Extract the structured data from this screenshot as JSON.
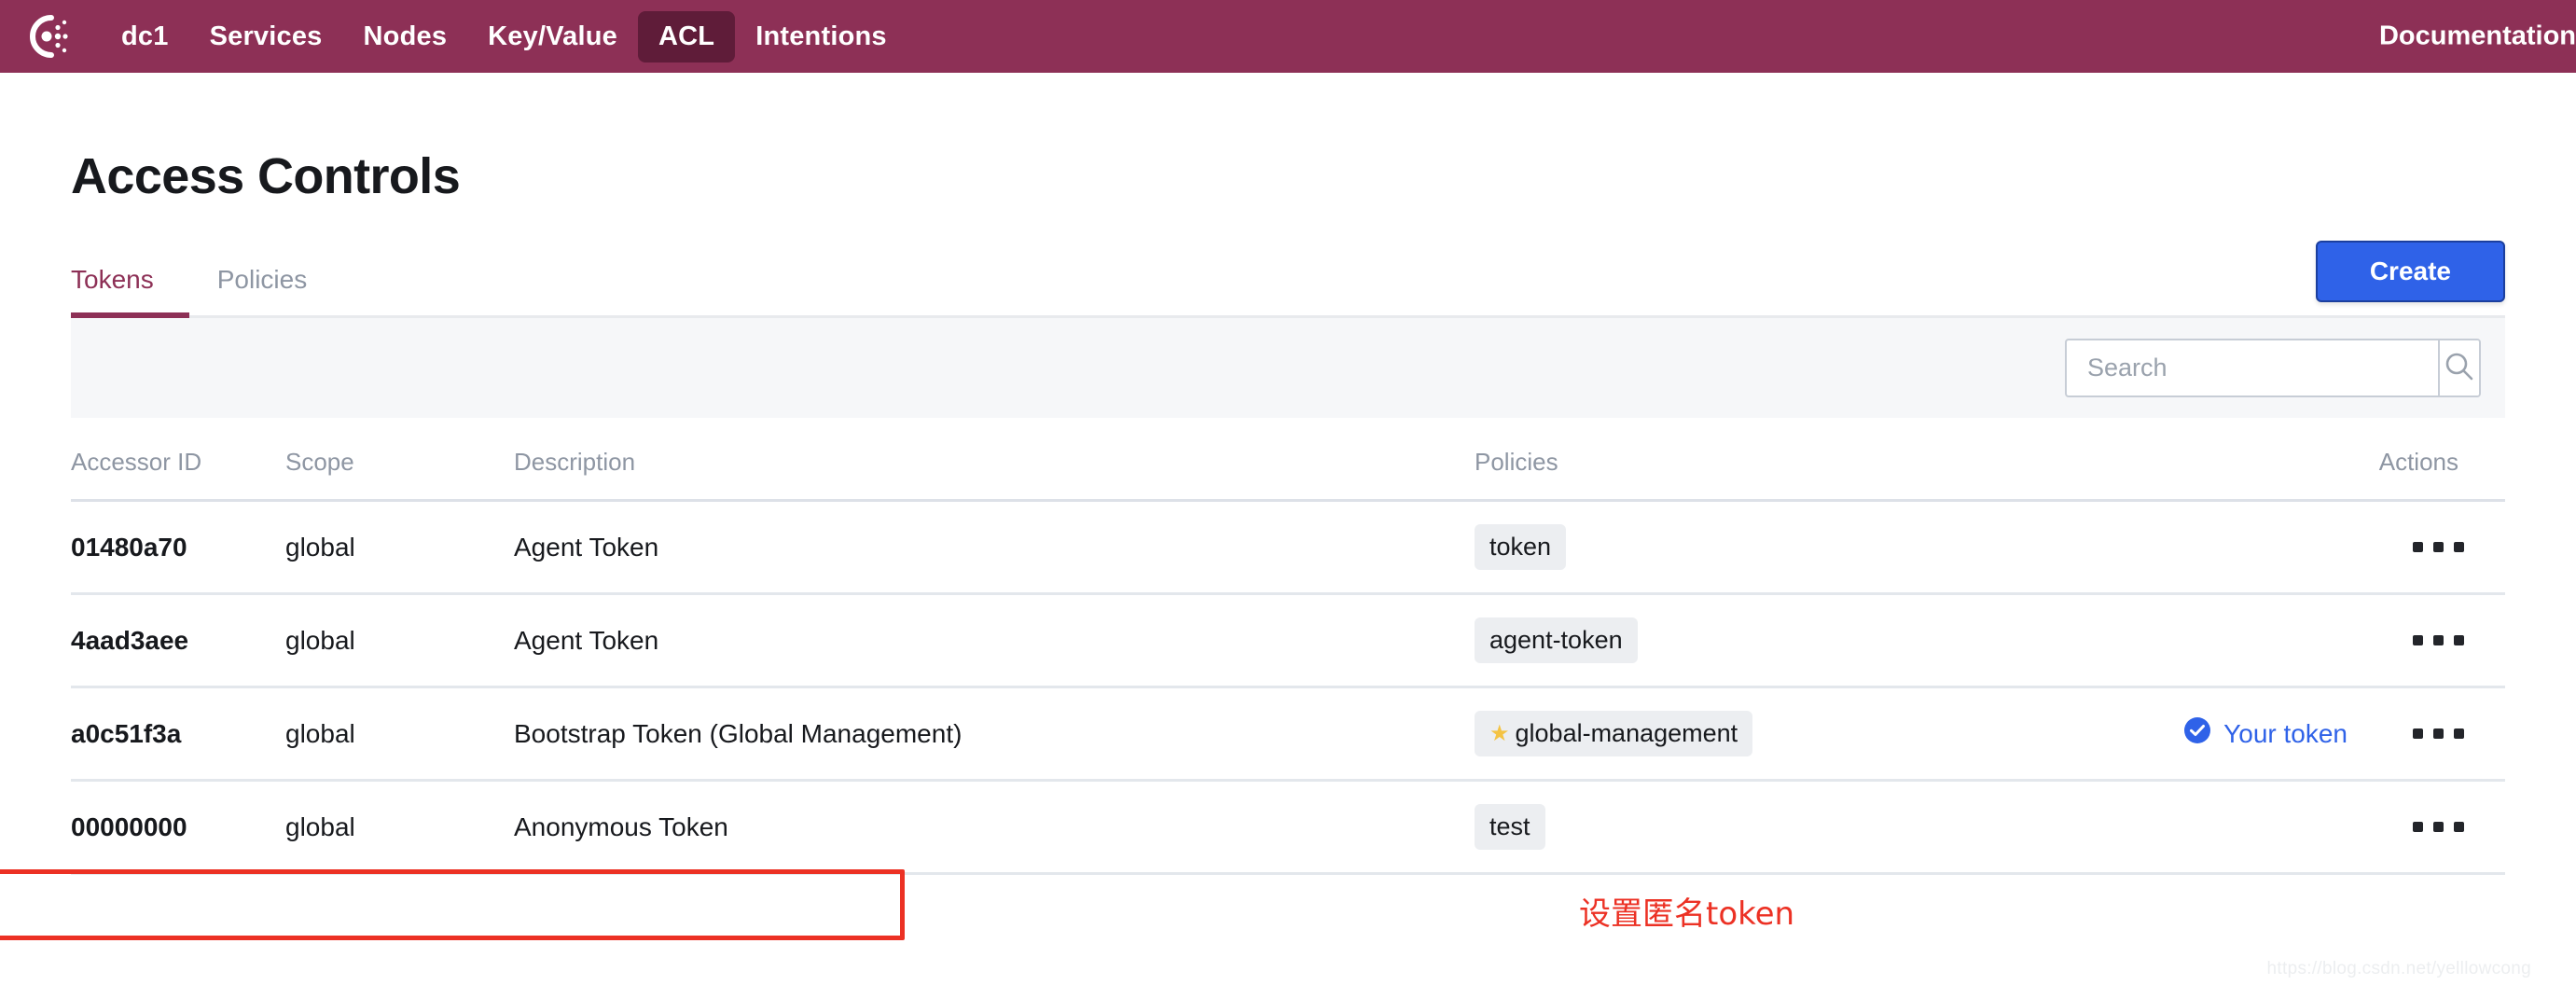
{
  "navbar": {
    "logo_icon": "consul-logo-icon",
    "brand_color": "#8d3056",
    "active_bg": "#5f1c39",
    "items": [
      {
        "label": "dc1",
        "active": false
      },
      {
        "label": "Services",
        "active": false
      },
      {
        "label": "Nodes",
        "active": false
      },
      {
        "label": "Key/Value",
        "active": false
      },
      {
        "label": "ACL",
        "active": true
      },
      {
        "label": "Intentions",
        "active": false
      }
    ],
    "documentation_label": "Documentation"
  },
  "page": {
    "title": "Access Controls"
  },
  "tabs": [
    {
      "label": "Tokens",
      "active": true
    },
    {
      "label": "Policies",
      "active": false
    }
  ],
  "actions": {
    "create_label": "Create",
    "create_color": "#2f62e8"
  },
  "search": {
    "placeholder": "Search",
    "value": "",
    "icon": "search-icon"
  },
  "table": {
    "headers": {
      "accessor_id": "Accessor ID",
      "scope": "Scope",
      "description": "Description",
      "policies": "Policies",
      "actions": "Actions"
    },
    "rows": [
      {
        "accessor_id": "01480a70",
        "scope": "global",
        "description": "Agent Token",
        "policy": "token",
        "policy_starred": false,
        "your_token": false,
        "highlighted": false
      },
      {
        "accessor_id": "4aad3aee",
        "scope": "global",
        "description": "Agent Token",
        "policy": "agent-token",
        "policy_starred": false,
        "your_token": false,
        "highlighted": false
      },
      {
        "accessor_id": "a0c51f3a",
        "scope": "global",
        "description": "Bootstrap Token (Global Management)",
        "policy": "global-management",
        "policy_starred": true,
        "your_token": true,
        "highlighted": false
      },
      {
        "accessor_id": "00000000",
        "scope": "global",
        "description": "Anonymous Token",
        "policy": "test",
        "policy_starred": false,
        "your_token": false,
        "highlighted": true
      }
    ],
    "your_token_label": "Your token",
    "your_token_color": "#2f62e8",
    "star_color": "#f4c343"
  },
  "annotation": {
    "text": "设置匿名token",
    "color": "#ec3124"
  },
  "watermark": {
    "text": "https://blog.csdn.net/yelllowcong"
  }
}
